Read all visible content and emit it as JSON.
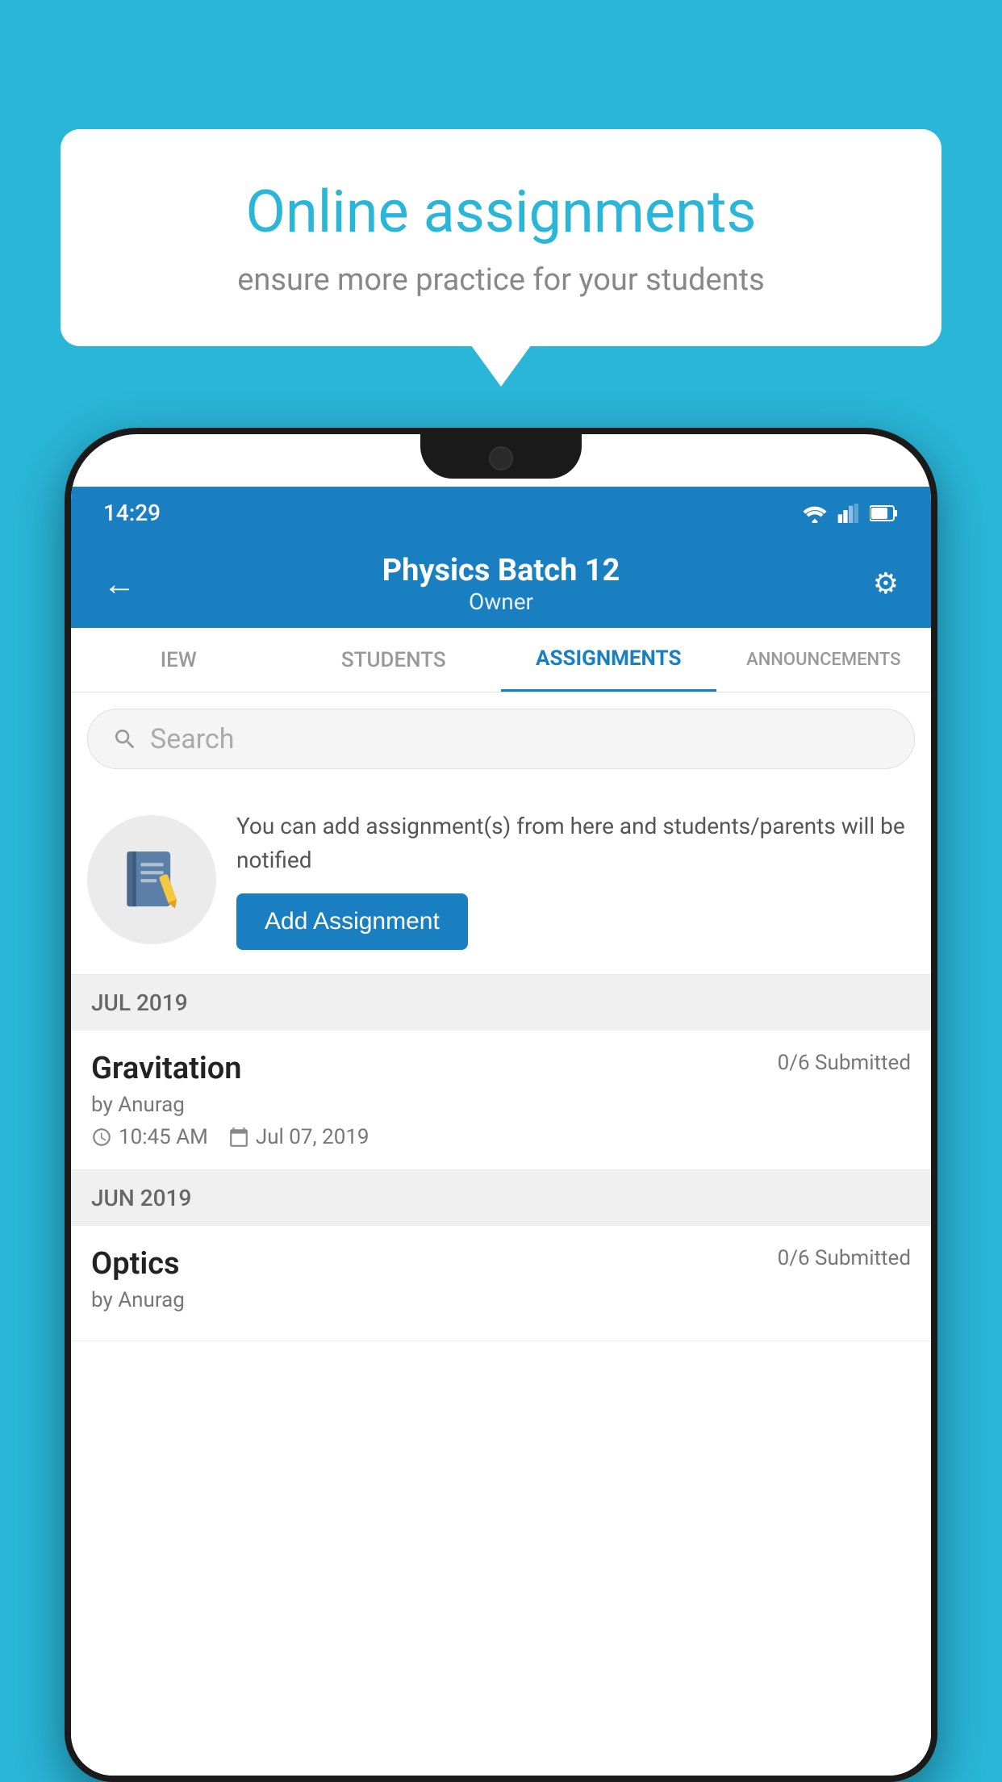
{
  "background_color": "#29b6d8",
  "promo": {
    "title": "Online assignments",
    "subtitle": "ensure more practice for your students"
  },
  "status_bar": {
    "time": "14:29"
  },
  "header": {
    "title": "Physics Batch 12",
    "subtitle": "Owner",
    "back_label": "←",
    "settings_label": "⚙"
  },
  "tabs": [
    {
      "label": "IEW",
      "active": false
    },
    {
      "label": "STUDENTS",
      "active": false
    },
    {
      "label": "ASSIGNMENTS",
      "active": true
    },
    {
      "label": "ANNOUNCEMENTS",
      "active": false
    }
  ],
  "search": {
    "placeholder": "Search"
  },
  "add_assignment_section": {
    "description": "You can add assignment(s) from here and students/parents will be notified",
    "button_label": "Add Assignment"
  },
  "sections": [
    {
      "month": "JUL 2019",
      "assignments": [
        {
          "name": "Gravitation",
          "submitted": "0/6 Submitted",
          "by": "by Anurag",
          "time": "10:45 AM",
          "date": "Jul 07, 2019"
        }
      ]
    },
    {
      "month": "JUN 2019",
      "assignments": [
        {
          "name": "Optics",
          "submitted": "0/6 Submitted",
          "by": "by Anurag",
          "time": "",
          "date": ""
        }
      ]
    }
  ]
}
